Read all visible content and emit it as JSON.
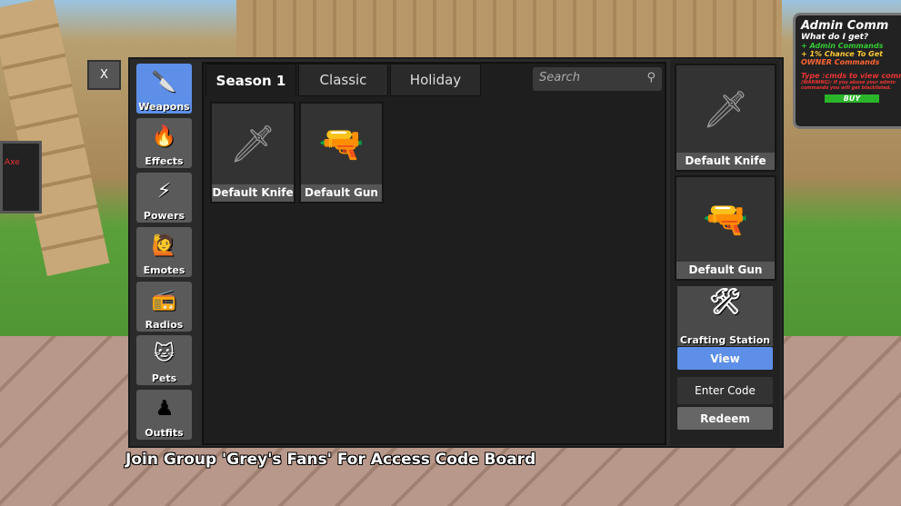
{
  "world": {
    "admin_sign": {
      "title": "Admin Comm",
      "question": "What do I get?",
      "line1": "+ Admin Commands",
      "line2": "+ 1% Chance To Get",
      "line3": "OWNER Commands",
      "hint": "Type :cmds to view comma",
      "warning": "(WARNING): If you abuse your admin commands you will get blacklisted.",
      "buy": "BUY"
    },
    "left_sign": "Axe"
  },
  "close": "X",
  "sidebar": [
    {
      "label": "Weapons",
      "icon": "knife-icon",
      "active": true
    },
    {
      "label": "Effects",
      "icon": "flame-knife-icon"
    },
    {
      "label": "Powers",
      "icon": "power-icon"
    },
    {
      "label": "Emotes",
      "icon": "emote-icon"
    },
    {
      "label": "Radios",
      "icon": "radio-icon"
    },
    {
      "label": "Pets",
      "icon": "cat-icon"
    },
    {
      "label": "Outfits",
      "icon": "outfit-icon"
    }
  ],
  "tabs": [
    {
      "label": "Season 1",
      "active": true
    },
    {
      "label": "Classic"
    },
    {
      "label": "Holiday"
    }
  ],
  "search": {
    "placeholder": "Search"
  },
  "items": [
    {
      "name": "Default Knife",
      "icon": "knife-icon"
    },
    {
      "name": "Default Gun",
      "icon": "revolver-icon"
    }
  ],
  "equipped": {
    "knife": "Default Knife",
    "gun": "Default Gun"
  },
  "crafting": {
    "label": "Crafting Station",
    "view": "View"
  },
  "codes": {
    "enter": "Enter Code",
    "redeem": "Redeem"
  },
  "bottom_text": "Join Group 'Grey's Fans' For Access Code Board",
  "colors": {
    "active": "#5d8fe8",
    "panel": "#2a2a2a"
  }
}
